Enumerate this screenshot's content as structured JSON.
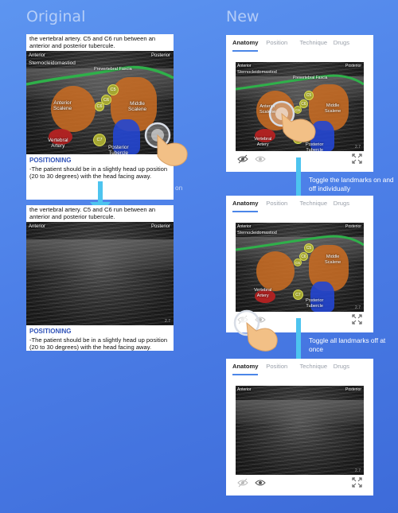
{
  "headings": {
    "original": "Original",
    "new": "New"
  },
  "original": {
    "top_text": "the vertebral artery. C5 and C6 run between an anterior and posterior tubercule.",
    "top_text2": "anterior and posterior tubercule.",
    "top_text_prefix": "the vertebral artery.",
    "top_text_suffix": "run between an",
    "positioning_title": "POSITIONING",
    "positioning_text": "-The patient should be in a slightly head up position (20 to 30 degrees) with the head facing away.",
    "caption": "All landmarks toggle on and off at once"
  },
  "ultrasound": {
    "anterior": "Anterior",
    "posterior": "Posterior",
    "sternocleidomastoid": "Sternocleidomastiod",
    "prevertebral_fascia": "Prevertebral Fascia",
    "anterior_scalene": "Anterior\nScalene",
    "middle_scalene": "Middle\nScalene",
    "vertebral_artery": "Vertebral\nArtery",
    "posterior_tubercle": "Posterior\nTubercle",
    "c5": "C5",
    "c6a": "C6",
    "c6b": "C6",
    "c7": "C7",
    "scale_number": "2.7"
  },
  "new": {
    "tabs": [
      "Anatomy",
      "Position",
      "Technique",
      "Drugs"
    ],
    "active_tab": "Anatomy",
    "caption1": "Toggle the landmarks on and off individually",
    "caption2": "Toggle all landmarks off at once"
  },
  "colors": {
    "accent": "#4b86e8",
    "arrow": "#4dc4ef",
    "muscle": "#c76b22",
    "artery": "#b52222",
    "fascia": "#2fb04a",
    "nerve": "#a4a632"
  }
}
